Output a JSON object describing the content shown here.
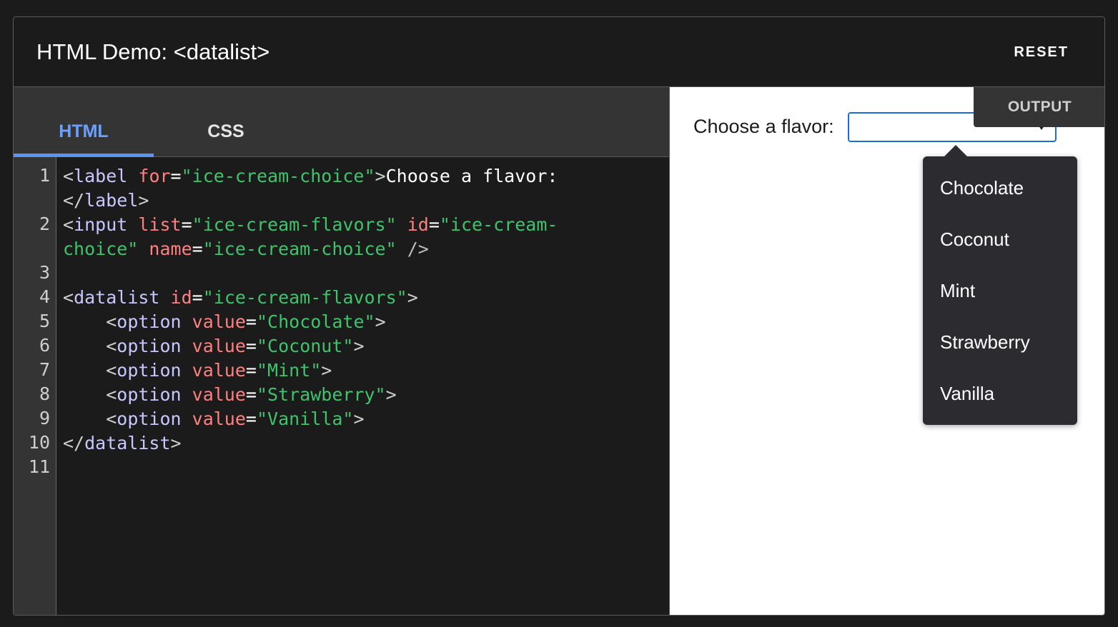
{
  "header": {
    "title": "HTML Demo: <datalist>",
    "reset_label": "RESET"
  },
  "editor": {
    "tabs": [
      {
        "label": "HTML",
        "active": true
      },
      {
        "label": "CSS",
        "active": false
      }
    ],
    "line_numbers": [
      "1",
      "2",
      "3",
      "4",
      "5",
      "6",
      "7",
      "8",
      "9",
      "10",
      "11"
    ],
    "code": {
      "l1": {
        "open": "<",
        "tag": "label",
        "attr": "for",
        "eq": "=",
        "val": "\"ice-cream-choice\"",
        "close": ">",
        "text": "Choose a flavor:"
      },
      "l1b": {
        "open": "</",
        "tag": "label",
        "close": ">"
      },
      "l2": {
        "open": "<",
        "tag": "input",
        "attr1": "list",
        "eq": "=",
        "val1": "\"ice-cream-flavors\"",
        "attr2": "id",
        "val2a": "\"ice-cream-"
      },
      "l2b": {
        "val2b": "choice\"",
        "attr3": "name",
        "eq": "=",
        "val3": "\"ice-cream-choice\"",
        "close": "/>"
      },
      "l4": {
        "open": "<",
        "tag": "datalist",
        "attr": "id",
        "eq": "=",
        "val": "\"ice-cream-flavors\"",
        "close": ">"
      },
      "options": [
        {
          "open": "<",
          "tag": "option",
          "attr": "value",
          "eq": "=",
          "val": "\"Chocolate\"",
          "close": ">"
        },
        {
          "open": "<",
          "tag": "option",
          "attr": "value",
          "eq": "=",
          "val": "\"Coconut\"",
          "close": ">"
        },
        {
          "open": "<",
          "tag": "option",
          "attr": "value",
          "eq": "=",
          "val": "\"Mint\"",
          "close": ">"
        },
        {
          "open": "<",
          "tag": "option",
          "attr": "value",
          "eq": "=",
          "val": "\"Strawberry\"",
          "close": ">"
        },
        {
          "open": "<",
          "tag": "option",
          "attr": "value",
          "eq": "=",
          "val": "\"Vanilla\"",
          "close": ">"
        }
      ],
      "l10": {
        "open": "</",
        "tag": "datalist",
        "close": ">"
      }
    }
  },
  "output": {
    "tag_label": "OUTPUT",
    "label": "Choose a flavor:",
    "input_value": "",
    "datalist_options": [
      "Chocolate",
      "Coconut",
      "Mint",
      "Strawberry",
      "Vanilla"
    ]
  },
  "colors": {
    "accent": "#5b94f5",
    "focus_border": "#1a6fd6",
    "string": "#3fc46b",
    "attribute": "#ff8080",
    "tag": "#c7c7ff"
  }
}
